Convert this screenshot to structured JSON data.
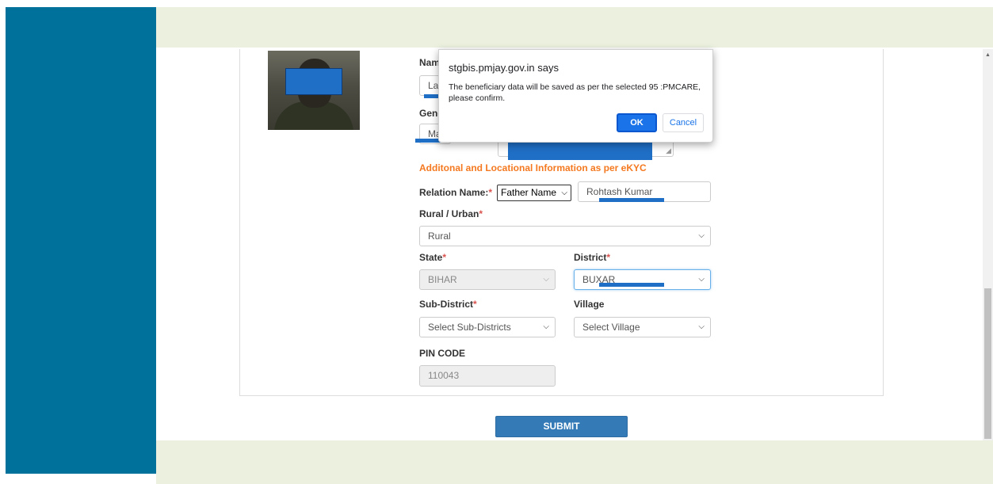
{
  "dialog": {
    "title": "stgbis.pmjay.gov.in says",
    "message": "The beneficiary data will be saved as per the selected 95 :PMCARE, please confirm.",
    "ok_label": "OK",
    "cancel_label": "Cancel"
  },
  "form": {
    "name_label_partial": "Nam",
    "name_value_partial": "Lal",
    "gender_label_partial": "Gend",
    "gender_value_partial": "Ma",
    "section_heading": "Additonal and Locational Information as per eKYC",
    "relation": {
      "label": "Relation Name:",
      "required_mark": "*",
      "type_selected": "Father Name",
      "value": "Rohtash Kumar"
    },
    "rural_urban": {
      "label": "Rural / Urban",
      "required_mark": "*",
      "selected": "Rural"
    },
    "state": {
      "label": "State",
      "required_mark": "*",
      "selected": "BIHAR"
    },
    "district": {
      "label": "District",
      "required_mark": "*",
      "selected": "BUXAR"
    },
    "sub_district": {
      "label": "Sub-District",
      "required_mark": "*",
      "selected": "Select Sub-Districts"
    },
    "village": {
      "label": "Village",
      "selected": "Select Village"
    },
    "pin_code": {
      "label": "PIN CODE",
      "value": "110043"
    },
    "submit_label": "SUBMIT"
  },
  "icons": {
    "select_caret": "chevron-down-icon",
    "scroll_up": "arrow-up-icon",
    "resize_grip": "resize-grip-icon"
  },
  "colors": {
    "sidebar": "#00719b",
    "band": "#ebf1de",
    "section_heading": "#f47920",
    "primary_button": "#337ab7",
    "dialog_ok": "#1a73e8",
    "redaction": "#1f6fc6"
  }
}
